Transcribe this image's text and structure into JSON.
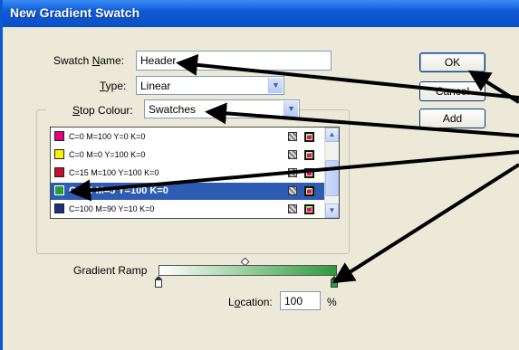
{
  "dialog": {
    "title": "New Gradient Swatch"
  },
  "swatch_name": {
    "label_pre": "Swatch ",
    "label_u": "N",
    "label_post": "ame:",
    "value": "Header"
  },
  "type": {
    "label_u": "T",
    "label_post": "ype:",
    "value": "Linear"
  },
  "stop_colour": {
    "label_u": "S",
    "label_post": "top Colour:",
    "value": "Swatches"
  },
  "buttons": {
    "ok": "OK",
    "cancel": "Cancel",
    "add": "Add"
  },
  "swatches": [
    {
      "label": "C=0 M=100 Y=0 K=0",
      "color": "#e4007f"
    },
    {
      "label": "C=0 M=0 Y=100 K=0",
      "color": "#fff200"
    },
    {
      "label": "C=15 M=100 Y=100 K=0",
      "color": "#c8102e"
    },
    {
      "label": "C=75 M=5 Y=100 K=0",
      "color": "#2e9a3e",
      "selected": true
    },
    {
      "label": "C=100 M=90 Y=10 K=0",
      "color": "#1c2f80"
    }
  ],
  "gradient_ramp": {
    "label": "Gradient Ramp",
    "start_color": "#ffffff",
    "end_color": "#2e9a3e"
  },
  "location": {
    "label_pre": "L",
    "label_u": "o",
    "label_post": "cation:",
    "value": "100",
    "unit": "%"
  },
  "colors": {
    "title_bar": "#0a5ad8",
    "selection": "#2f5cb3",
    "annotation_arrow": "#000000"
  }
}
